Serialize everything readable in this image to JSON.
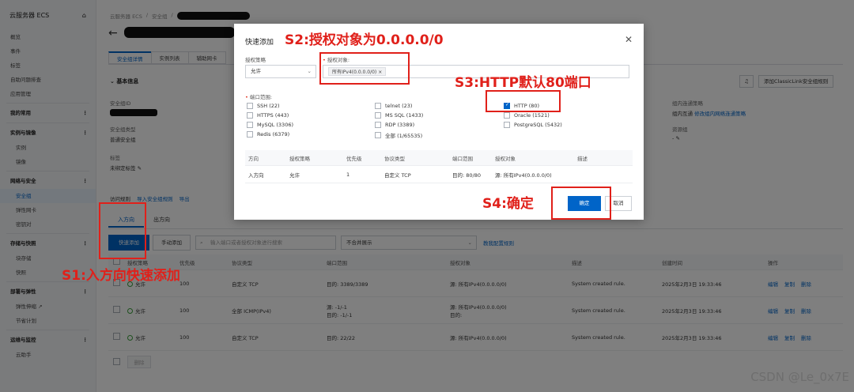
{
  "sidebar": {
    "title": "云服务器 ECS",
    "items_top": [
      "概览",
      "事件",
      "标签",
      "自助问题排查",
      "应用管理"
    ],
    "my_common": "我的常用",
    "groups": [
      {
        "title": "实例与镜像",
        "items": [
          "实例",
          "镜像"
        ]
      },
      {
        "title": "网络与安全",
        "items": [
          "安全组",
          "弹性网卡",
          "密钥对"
        ]
      },
      {
        "title": "存储与快照",
        "items": [
          "块存储",
          "快照"
        ]
      },
      {
        "title": "部署与弹性",
        "items": [
          "弹性伸缩",
          "节省计划"
        ]
      },
      {
        "title": "运维与监控",
        "items": [
          "云助手"
        ]
      }
    ]
  },
  "breadcrumb": [
    "云服务器 ECS",
    "/",
    "安全组",
    "/"
  ],
  "page_tabs": [
    "安全组详情",
    "实例列表",
    "辅助网卡"
  ],
  "basic_info": {
    "title": "基本信息",
    "sg_id_label": "安全组ID",
    "sg_type_label": "安全组类型",
    "sg_type_value": "普通安全组",
    "tag_label": "标签",
    "tag_value": "未绑定标签",
    "cross_label": "组内连通策略",
    "cross_value_prefix": "组内互通",
    "cross_link": "修改组内网络连通策略",
    "rg_label": "资源组",
    "rg_value": "-",
    "classic_btn": "添加ClassicLink安全组规则"
  },
  "access": {
    "title": "访问规则",
    "import": "导入安全组规则",
    "export": "导出",
    "tabs": [
      "入方向",
      "出方向"
    ],
    "quick_add": "快速添加",
    "manual_add": "手动添加",
    "search_placeholder": "输入端口或者授权对象进行搜索",
    "merge_select": "不合并展示",
    "tutorial": "教我配置规则"
  },
  "table": {
    "headers": [
      "授权策略",
      "优先级",
      "协议类型",
      "端口范围",
      "授权对象",
      "描述",
      "创建时间",
      "操作"
    ],
    "rows": [
      {
        "policy": "允许",
        "priority": "100",
        "protocol": "自定义 TCP",
        "port": "目的: 3389/3389",
        "port2": "",
        "target": "源: 所有IPv4(0.0.0.0/0)",
        "target2": "",
        "desc": "System created rule.",
        "time": "2025年2月3日 19:33:46"
      },
      {
        "policy": "允许",
        "priority": "100",
        "protocol": "全部 ICMP(IPv4)",
        "port": "源: -1/-1",
        "port2": "目的: -1/-1",
        "target": "源: 所有IPv4(0.0.0.0/0)",
        "target2": "目的:",
        "desc": "System created rule.",
        "time": "2025年2月3日 19:33:46"
      },
      {
        "policy": "允许",
        "priority": "100",
        "protocol": "自定义 TCP",
        "port": "目的: 22/22",
        "port2": "",
        "target": "源: 所有IPv4(0.0.0.0/0)",
        "target2": "",
        "desc": "System created rule.",
        "time": "2025年2月3日 19:33:46"
      }
    ],
    "ops": [
      "编辑",
      "复制",
      "删除"
    ],
    "bulk_delete": "删除"
  },
  "modal": {
    "title": "快速添加",
    "policy_label": "授权策略",
    "policy_value": "允许",
    "target_label": "授权对象:",
    "target_chip": "所有IPv4(0.0.0.0/0)",
    "port_label": "端口范围:",
    "ports": [
      {
        "label": "SSH (22)",
        "checked": false
      },
      {
        "label": "HTTPS (443)",
        "checked": false
      },
      {
        "label": "MySQL (3306)",
        "checked": false
      },
      {
        "label": "Redis (6379)",
        "checked": false
      },
      {
        "label": "telnet (23)",
        "checked": false
      },
      {
        "label": "MS SQL (1433)",
        "checked": false
      },
      {
        "label": "RDP (3389)",
        "checked": false
      },
      {
        "label": "全部 (1/65535)",
        "checked": false
      },
      {
        "label": "HTTP (80)",
        "checked": true
      },
      {
        "label": "Oracle (1521)",
        "checked": false
      },
      {
        "label": "PostgreSQL (5432)",
        "checked": false
      }
    ],
    "preview_headers": [
      "方向",
      "授权策略",
      "优先级",
      "协议类型",
      "端口范围",
      "授权对象",
      "描述"
    ],
    "preview_row": [
      "入方向",
      "允许",
      "1",
      "自定义 TCP",
      "目的: 80/80",
      "源: 所有IPv4(0.0.0.0/0)",
      ""
    ],
    "ok": "确定",
    "cancel": "取消"
  },
  "annotations": {
    "s1": "S1:入方向快速添加",
    "s2": "S2:授权对象为0.0.0.0/0",
    "s3": "S3:HTTP默认80端口",
    "s4": "S4:确定",
    "color": "#e0201a"
  },
  "watermark": "CSDN @Le_0x7E",
  "colors": {
    "primary": "#0064c8",
    "danger": "#e0301e",
    "overlay": "rgba(0,0,0,0.5)"
  }
}
